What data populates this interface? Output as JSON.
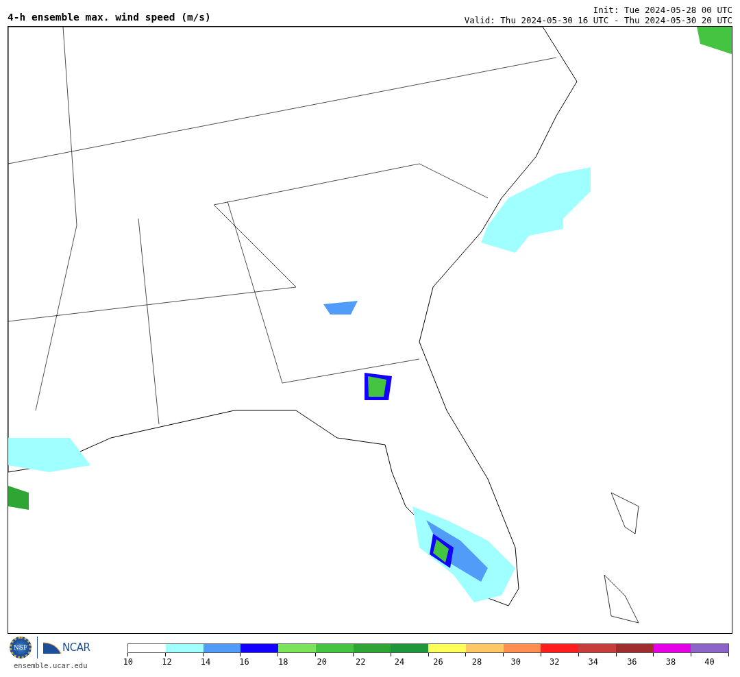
{
  "header": {
    "title": "4-h ensemble max. wind speed (m/s)",
    "init": "Init: Tue 2024-05-28 00 UTC",
    "valid": "Valid: Thu 2024-05-30 16 UTC - Thu 2024-05-30 20 UTC"
  },
  "footer": {
    "logos": [
      "NSF",
      "NCAR"
    ],
    "site": "ensemble.ucar.edu"
  },
  "colorbar": {
    "segments": [
      {
        "color": "#ffffff"
      },
      {
        "color": "#a0ffff"
      },
      {
        "color": "#509cf8"
      },
      {
        "color": "#1400ff"
      },
      {
        "color": "#7ce45a"
      },
      {
        "color": "#44c440"
      },
      {
        "color": "#2fa534"
      },
      {
        "color": "#1e963c"
      },
      {
        "color": "#ffff5a"
      },
      {
        "color": "#ffc864"
      },
      {
        "color": "#ff8c50"
      },
      {
        "color": "#ff1e1e"
      },
      {
        "color": "#c83c3c"
      },
      {
        "color": "#a02d2d"
      },
      {
        "color": "#e600e6"
      },
      {
        "color": "#8c64c8"
      }
    ],
    "ticks": [
      "10",
      "12",
      "14",
      "16",
      "18",
      "20",
      "22",
      "24",
      "26",
      "28",
      "30",
      "32",
      "34",
      "36",
      "38",
      "40"
    ]
  }
}
